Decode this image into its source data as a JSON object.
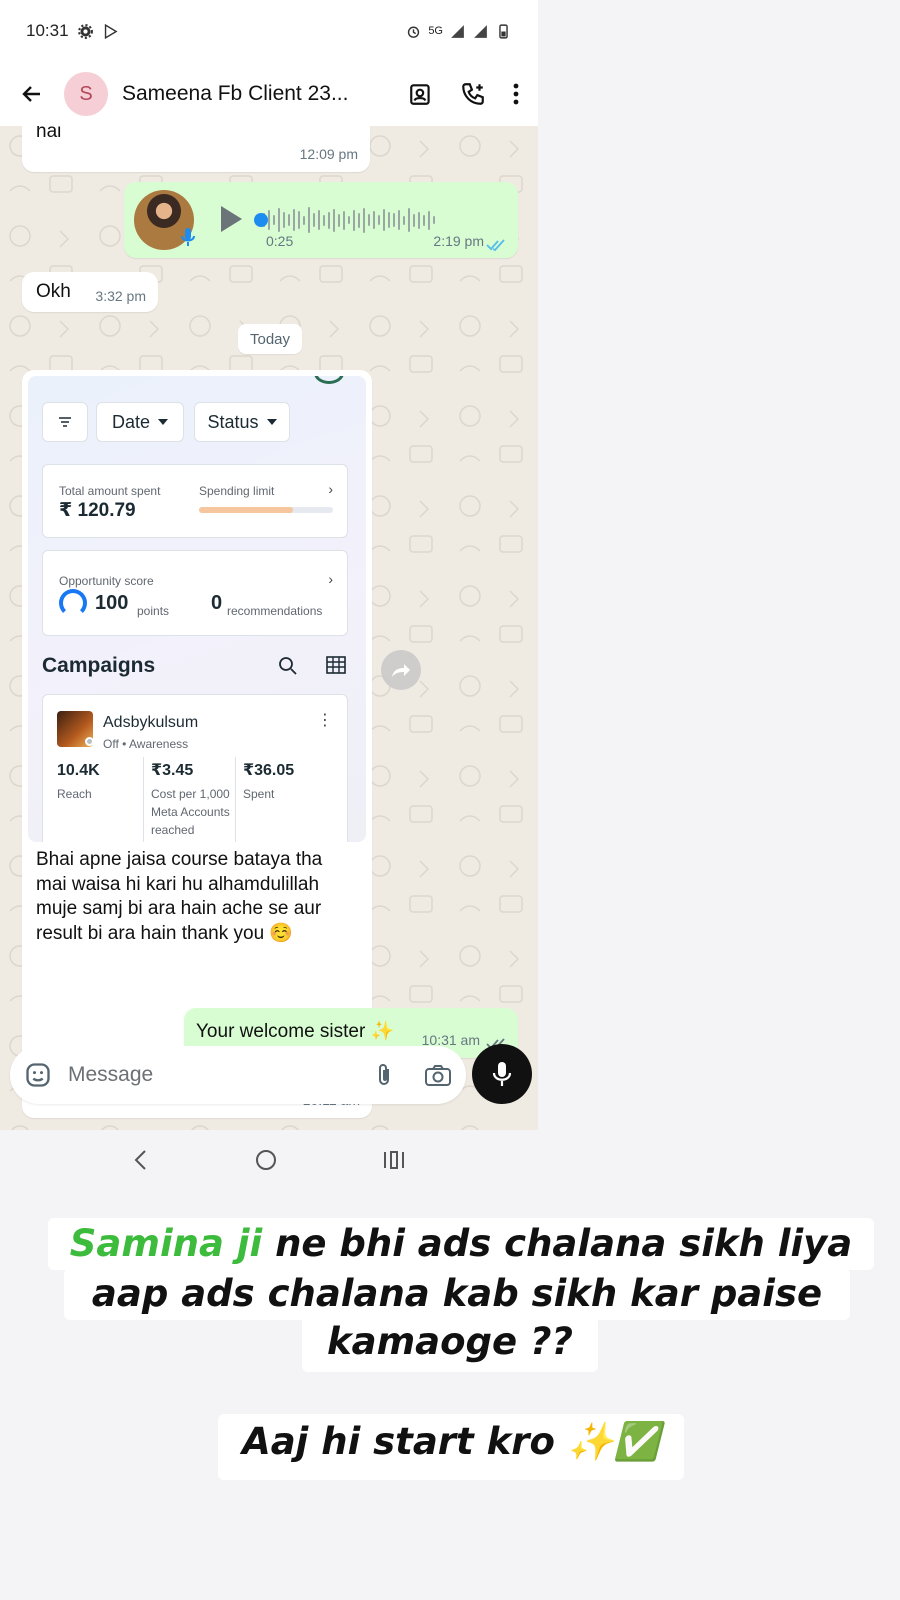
{
  "status_bar": {
    "time": "10:31",
    "network": "5G"
  },
  "chat_header": {
    "avatar_letter": "S",
    "title": "Sameena Fb Client 23..."
  },
  "messages": {
    "m1": {
      "text": "hai",
      "time": "12:09 pm"
    },
    "voice": {
      "duration": "0:25",
      "time": "2:19 pm"
    },
    "okh": {
      "text": "Okh",
      "time": "3:32 pm"
    },
    "date_divider": "Today",
    "image_msg": {
      "screenshot": {
        "filters": {
          "date": "Date",
          "status": "Status"
        },
        "spend": {
          "total_label": "Total amount spent",
          "limit_label": "Spending limit",
          "total_value": "₹ 120.79",
          "limit_progress": 0.7
        },
        "opportunity": {
          "label": "Opportunity score",
          "points": "100",
          "points_label": "points",
          "recommendations": "0",
          "recommendations_label": "recommendations"
        },
        "campaigns_title": "Campaigns",
        "campaign": {
          "name": "Adsbykulsum",
          "status": "Off • Awareness",
          "reach_value": "10.4K",
          "reach_label": "Reach",
          "cost_value": "₹3.45",
          "cost_label": "Cost per 1,000 Meta Accounts reached",
          "spent_value": "₹36.05",
          "spent_label": "Spent"
        }
      },
      "caption": "Bhai apne jaisa course bataya tha mai waisa hi kari hu alhamdulillah muje samj bi ara hain ache se aur result bi ara hain thank you ☺️",
      "time": "10:11 am"
    },
    "welcome": {
      "text": "Your welcome sister ✨",
      "time": "10:31 am"
    }
  },
  "input_bar": {
    "placeholder": "Message"
  },
  "promo": {
    "line1_highlight": "Samina ji",
    "line1_rest": " ne bhi ads chalana sikh liya",
    "line2": "aap ads chalana kab sikh kar paise",
    "line3": "kamaoge ??",
    "line4": "Aaj hi start kro ✨✅"
  },
  "colors": {
    "accent_green": "#3dbb3d",
    "outgoing_bubble": "#d9fdd3",
    "chat_bg": "#efeae2",
    "read_ticks": "#53bdeb"
  }
}
